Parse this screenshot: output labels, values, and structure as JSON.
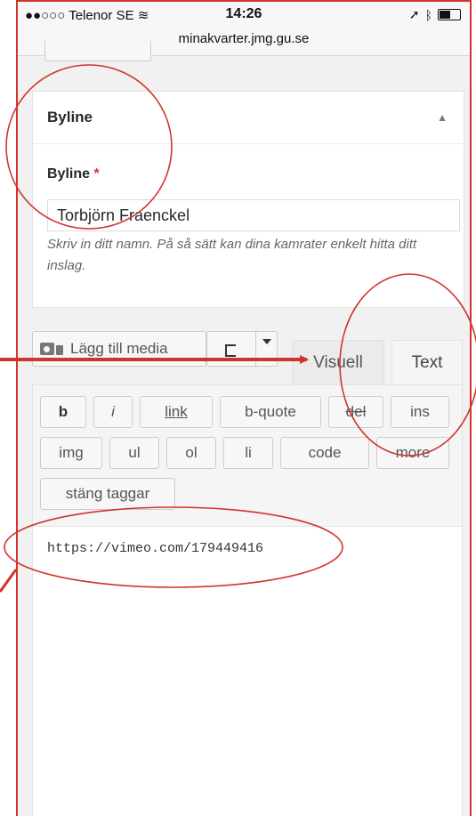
{
  "status_bar": {
    "carrier": "●●○○○ Telenor SE",
    "time": "14:26",
    "url": "minakvarter.jmg.gu.se"
  },
  "byline_panel": {
    "title": "Byline",
    "field_label": "Byline",
    "required_mark": "*",
    "field_value": "Torbjörn Fraenckel",
    "description": "Skriv in ditt namn. På så sätt kan dina kamrater enkelt hitta ditt inslag."
  },
  "editor": {
    "add_media_label": "Lägg till media",
    "tab_visual": "Visuell",
    "tab_text": "Text",
    "quicktags": [
      "b",
      "i",
      "link",
      "b-quote",
      "del",
      "ins",
      "img",
      "ul",
      "ol",
      "li",
      "code",
      "more",
      "stäng taggar"
    ],
    "content": "https://vimeo.com/179449416"
  },
  "annotation_color": "#d0342c"
}
